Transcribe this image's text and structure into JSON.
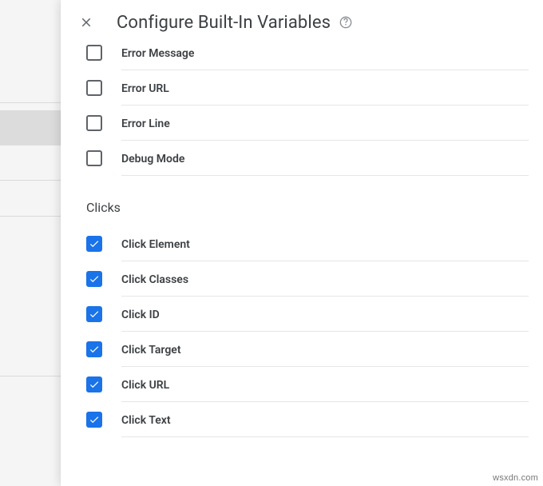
{
  "header": {
    "title": "Configure Built-In Variables"
  },
  "groups": [
    {
      "title": "",
      "items": [
        {
          "label": "Error Message",
          "checked": false
        },
        {
          "label": "Error URL",
          "checked": false
        },
        {
          "label": "Error Line",
          "checked": false
        },
        {
          "label": "Debug Mode",
          "checked": false
        }
      ]
    },
    {
      "title": "Clicks",
      "items": [
        {
          "label": "Click Element",
          "checked": true
        },
        {
          "label": "Click Classes",
          "checked": true
        },
        {
          "label": "Click ID",
          "checked": true
        },
        {
          "label": "Click Target",
          "checked": true
        },
        {
          "label": "Click URL",
          "checked": true
        },
        {
          "label": "Click Text",
          "checked": true
        }
      ]
    }
  ],
  "watermark": "wsxdn.com"
}
